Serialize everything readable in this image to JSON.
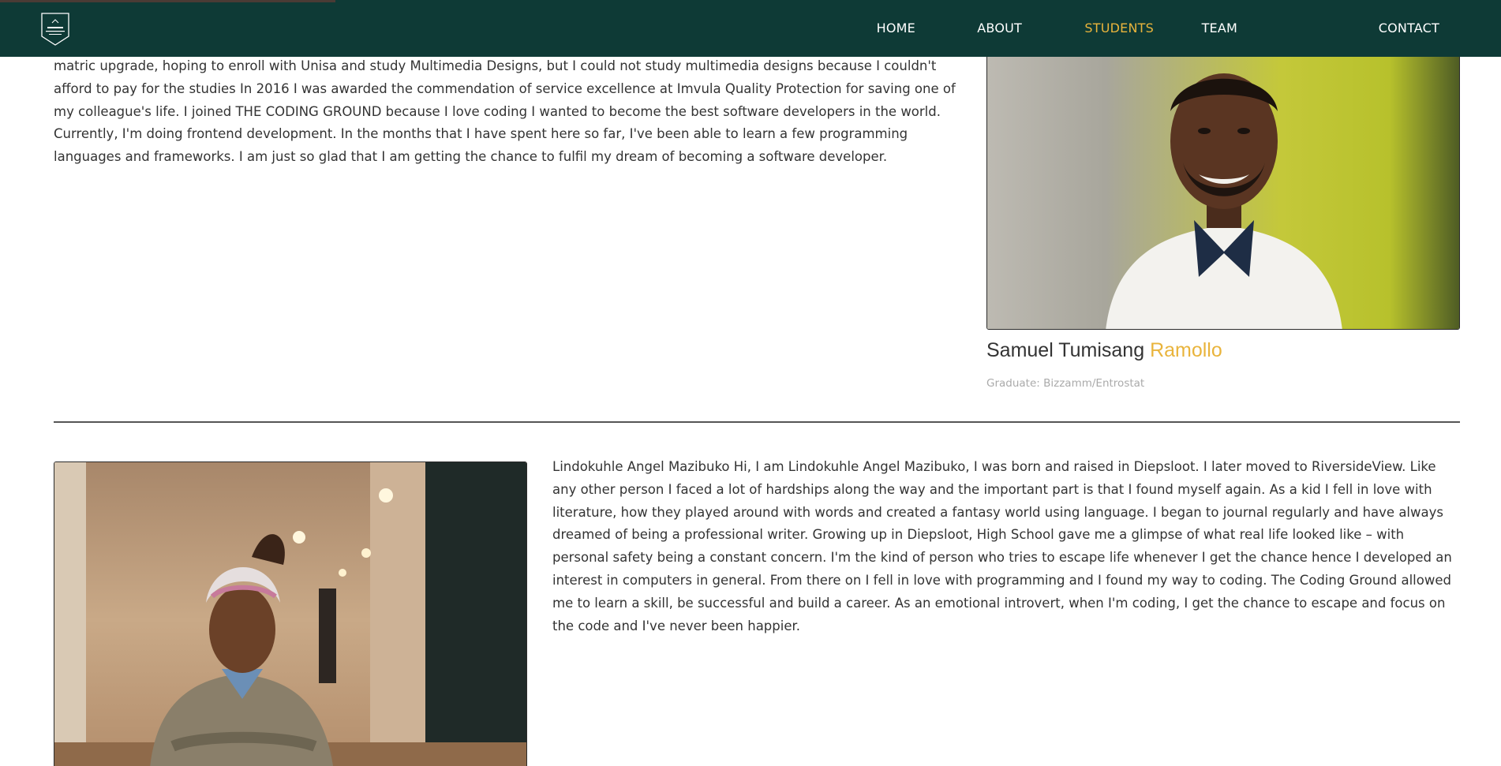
{
  "nav": {
    "items": [
      {
        "label": "HOME"
      },
      {
        "label": "ABOUT"
      },
      {
        "label": "STUDENTS",
        "active": true
      },
      {
        "label": "TEAM"
      },
      {
        "label": "CONTACT"
      }
    ]
  },
  "colors": {
    "topbar": "#0e3a36",
    "accent": "#e9b43c"
  },
  "students": [
    {
      "bio": "matric upgrade, hoping to enroll with Unisa and study Multimedia Designs, but I could not study multimedia designs because I couldn't afford to pay for the studies In 2016 I was awarded the commendation of service excellence at Imvula Quality Protection for saving one of my colleague's life. I joined THE CODING GROUND because I love coding I wanted to become the best software developers in the world. Currently, I'm doing frontend development. In the months that I have spent here so far, I've been able to learn a few programming languages and frameworks. I am just so glad that I am getting the chance to fulfil my dream of becoming a software developer.",
      "first_name": "Samuel Tumisang",
      "last_name": "Ramollo",
      "role": "Graduate: Bizzamm/Entrostat"
    },
    {
      "bio": "Lindokuhle Angel Mazibuko Hi, I am Lindokuhle Angel Mazibuko, I was born and raised in Diepsloot. I later moved to RiversideView. Like any other person I faced a lot of hardships along the way and the important part is that I found myself again. As a kid I fell in love with literature, how they played around with words and created a fantasy world using language. I began to journal regularly and have always dreamed of being a professional writer. Growing up in Diepsloot, High School gave me a glimpse of what real life looked like – with personal safety being a constant concern. I'm the kind of person who tries to escape life whenever I get the chance hence I developed an interest in computers in general. From there on I fell in love with programming and I found my way to coding. The Coding Ground allowed me to learn a skill, be successful and build a career. As an emotional introvert, when I'm coding, I get the chance to escape and focus on the code and I've never been happier."
    }
  ]
}
